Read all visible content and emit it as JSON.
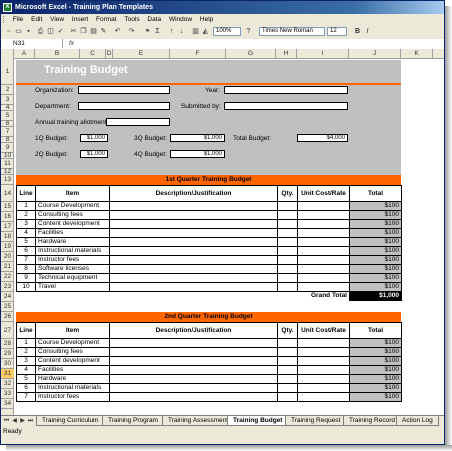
{
  "window": {
    "title": "Microsoft Excel - Training Plan Templates"
  },
  "menu": [
    "File",
    "Edit",
    "View",
    "Insert",
    "Format",
    "Tools",
    "Data",
    "Window",
    "Help"
  ],
  "toolbar": {
    "zoom": "100%",
    "font": "Times New Roman",
    "size": "12",
    "bold": "B",
    "italic": "I"
  },
  "formula": {
    "namebox": "N31",
    "fx": "fx"
  },
  "columns": [
    "A",
    "B",
    "C",
    "D",
    "E",
    "F",
    "G",
    "H",
    "I",
    "J",
    "K"
  ],
  "rows": [
    "1",
    "2",
    "3",
    "4",
    "5",
    "6",
    "7",
    "8",
    "9",
    "10",
    "11",
    "12",
    "13",
    "14",
    "15",
    "16",
    "17",
    "18",
    "19",
    "20",
    "21",
    "22",
    "23",
    "24",
    "25",
    "26",
    "27",
    "28",
    "29",
    "30",
    "31",
    "32",
    "33",
    "34"
  ],
  "sheet": {
    "title": "Training Budget",
    "org_label": "Organization:",
    "year_label": "Year:",
    "dept_label": "Department:",
    "submitted_label": "Submitted by:",
    "annual_label": "Annual training allotment",
    "q1_label": "1Q Budget:",
    "q1_value": "$1,000",
    "q3_label": "3Q Budget:",
    "q3_value": "$1,000",
    "total_label": "Total Budget:",
    "total_value": "$4,000",
    "q2_label": "2Q Budget:",
    "q2_value": "$1,000",
    "q4_label": "4Q Budget:",
    "q4_value": "$1,000"
  },
  "q1": {
    "title": "1st Quarter Training Budget",
    "headers": {
      "line": "Line",
      "item": "Item",
      "desc": "Description/Justification",
      "qty": "Qty.",
      "unit": "Unit Cost/Rate",
      "total": "Total"
    },
    "rows": [
      {
        "line": "1",
        "item": "Course Development",
        "total": "$100"
      },
      {
        "line": "2",
        "item": "Consulting fees",
        "total": "$100"
      },
      {
        "line": "3",
        "item": "Content development",
        "total": "$100"
      },
      {
        "line": "4",
        "item": "Facilities",
        "total": "$100"
      },
      {
        "line": "5",
        "item": "Hardware",
        "total": "$100"
      },
      {
        "line": "6",
        "item": "Instructional materials",
        "total": "$100"
      },
      {
        "line": "7",
        "item": "Instructor fees",
        "total": "$100"
      },
      {
        "line": "8",
        "item": "Software licenses",
        "total": "$100"
      },
      {
        "line": "9",
        "item": "Technical equipment",
        "total": "$100"
      },
      {
        "line": "10",
        "item": "Travel",
        "total": "$100"
      }
    ],
    "grand_total_label": "Grand Total",
    "grand_total_value": "$1,000"
  },
  "q2": {
    "title": "2nd Quarter Training Budget",
    "headers": {
      "line": "Line",
      "item": "Item",
      "desc": "Description/Justification",
      "qty": "Qty.",
      "unit": "Unit Cost/Rate",
      "total": "Total"
    },
    "rows": [
      {
        "line": "1",
        "item": "Course Development",
        "total": "$100"
      },
      {
        "line": "2",
        "item": "Consulting fees",
        "total": "$100"
      },
      {
        "line": "3",
        "item": "Content development",
        "total": "$100"
      },
      {
        "line": "4",
        "item": "Facilities",
        "total": "$100"
      },
      {
        "line": "5",
        "item": "Hardware",
        "total": "$100"
      },
      {
        "line": "6",
        "item": "Instructional materials",
        "total": "$100"
      },
      {
        "line": "7",
        "item": "Instructor fees",
        "total": "$100"
      }
    ]
  },
  "tabs": [
    "Training Curriculum",
    "Training Program",
    "Training Assessment",
    "Training Budget",
    "Training Request",
    "Training Record",
    "Action Log"
  ],
  "status": "Ready"
}
